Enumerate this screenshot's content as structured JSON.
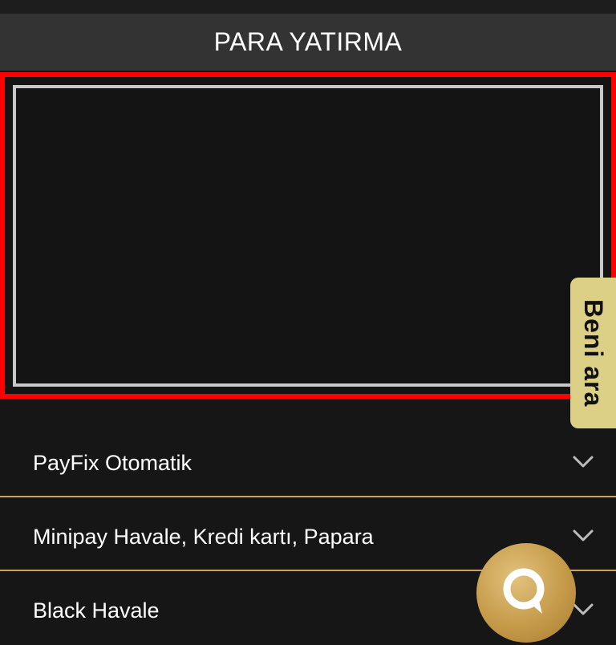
{
  "header": {
    "title": "PARA YATIRMA"
  },
  "callback": {
    "label": "Beni ara"
  },
  "accordion": {
    "items": [
      {
        "label": "PayFix Otomatik"
      },
      {
        "label": "Minipay Havale, Kredi kartı, Papara"
      },
      {
        "label": "Black Havale"
      }
    ]
  },
  "icons": {
    "chevron": "chevron-down-icon",
    "chat": "chat-bubble-icon"
  },
  "colors": {
    "background": "#161616",
    "header": "#333333",
    "highlight_border": "#ff0000",
    "divider": "#c9a45a",
    "callback_tab": "#dccf86",
    "chat_button": "#c59a49"
  }
}
